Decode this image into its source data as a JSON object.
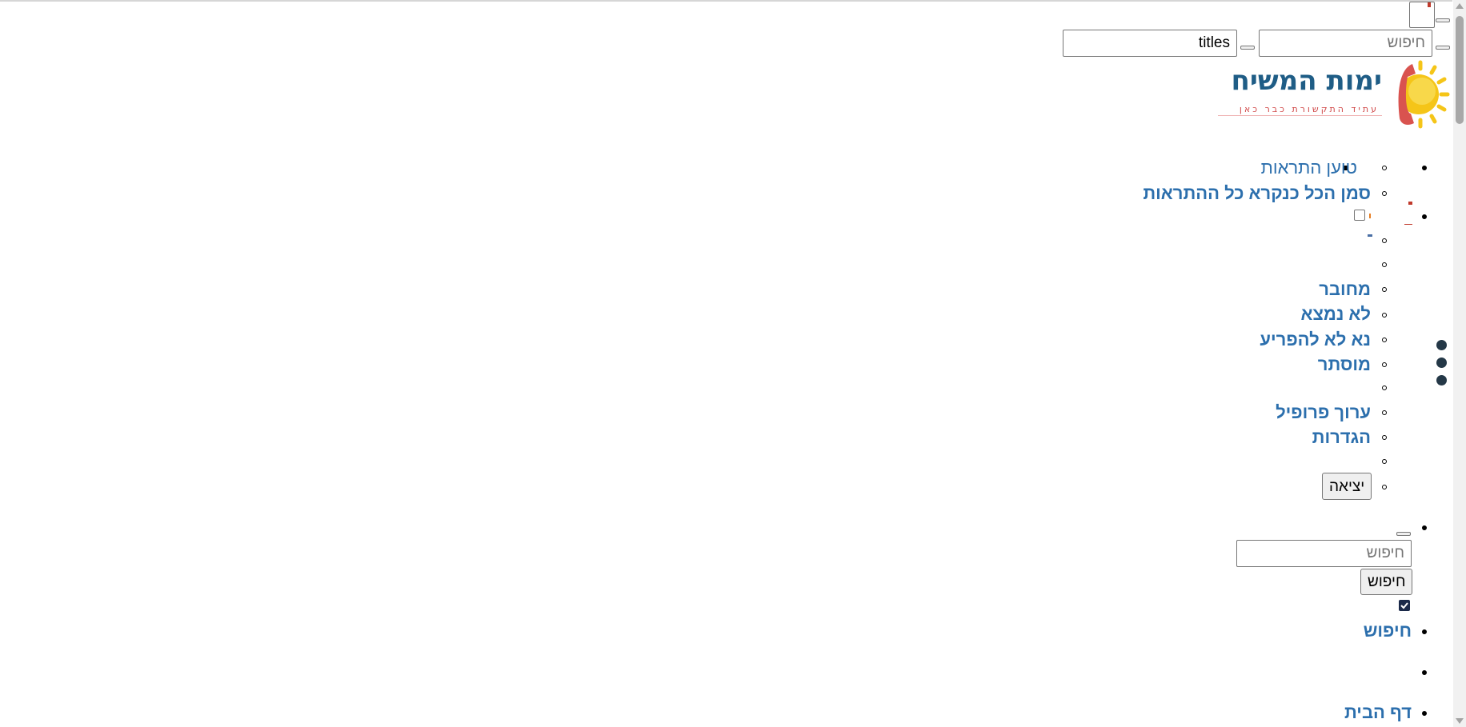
{
  "header": {
    "search_placeholder": "חיפוש",
    "titles_value": "titles"
  },
  "logo": {
    "title": "ימות המשיח",
    "tagline": "עתיד התקשורת כבר כאן"
  },
  "notifications": {
    "loading": "טוען התראות",
    "mark_all_read": "סמן הכל כנקרא כל ההתראות"
  },
  "user_menu": {
    "status_online": "מחובר",
    "status_away": "לא נמצא",
    "status_dnd": "נא לא להפריע",
    "status_invisible": "מוסתר",
    "edit_profile": "ערוך פרופיל",
    "settings": "הגדרות",
    "logout": "יציאה"
  },
  "search_panel": {
    "placeholder": "חיפוש",
    "button_label": "חיפוש",
    "link_label": "חיפוש"
  },
  "nav": {
    "home": "דף הבית"
  },
  "colors": {
    "link": "#2c6fad",
    "logo_blue": "#1f5d86",
    "logo_red": "#d14a4a",
    "logo_sun": "#f5c518",
    "dots": "#243847"
  },
  "icons": {
    "sun": "sun-icon",
    "phone": "phone-handset-icon",
    "menu": "vertical-dots-icon"
  }
}
